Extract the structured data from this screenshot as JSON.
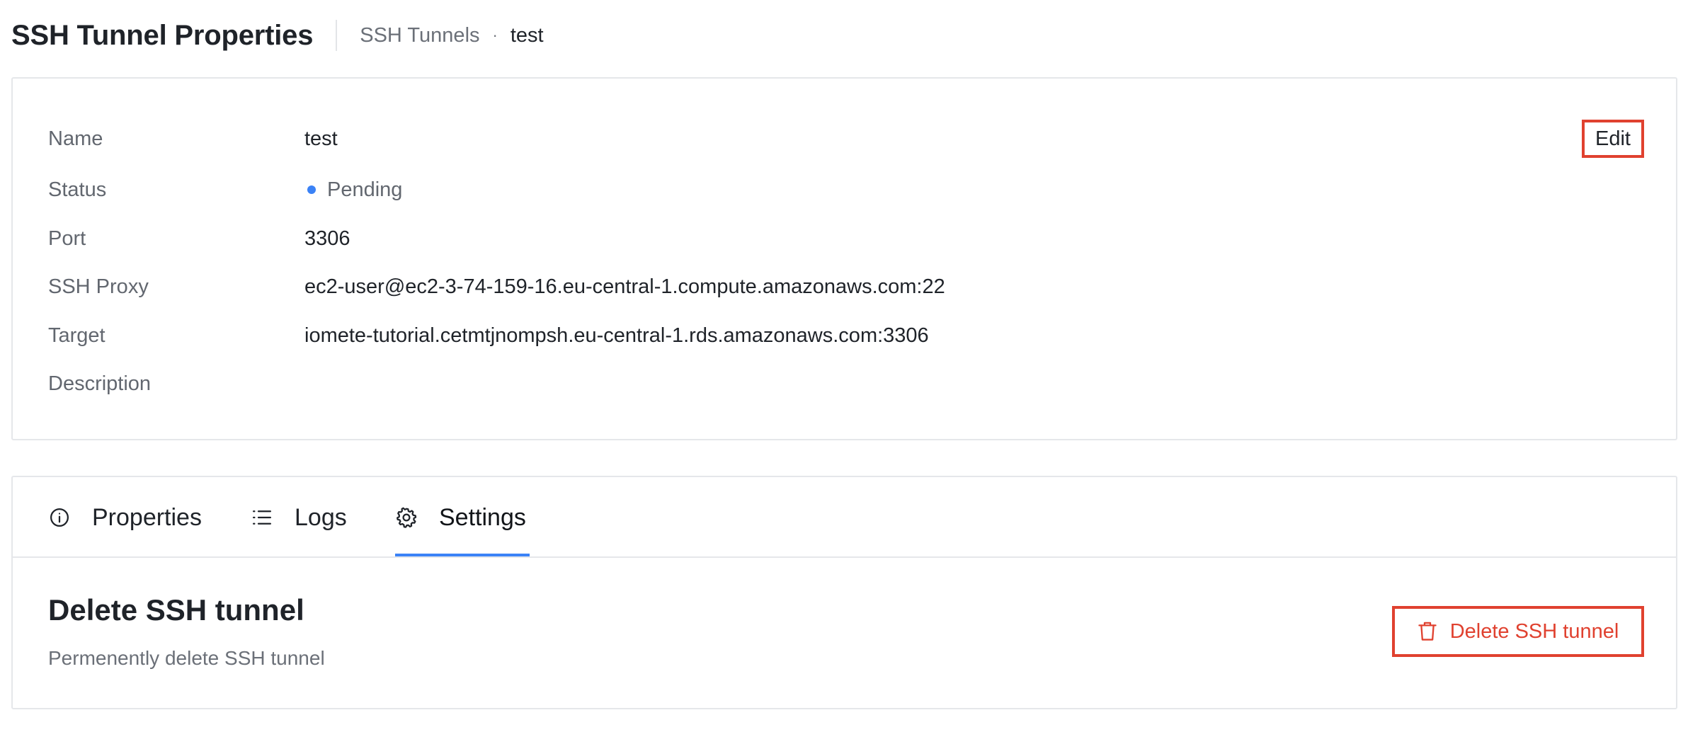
{
  "header": {
    "title": "SSH Tunnel Properties",
    "breadcrumb": {
      "parent": "SSH Tunnels",
      "separator": "·",
      "current": "test"
    }
  },
  "details": {
    "edit_label": "Edit",
    "rows": [
      {
        "label": "Name",
        "value": "test"
      },
      {
        "label": "Status",
        "value": "Pending"
      },
      {
        "label": "Port",
        "value": "3306"
      },
      {
        "label": "SSH Proxy",
        "value": "ec2-user@ec2-3-74-159-16.eu-central-1.compute.amazonaws.com:22"
      },
      {
        "label": "Target",
        "value": "iomete-tutorial.cetmtjnompsh.eu-central-1.rds.amazonaws.com:3306"
      },
      {
        "label": "Description",
        "value": ""
      }
    ],
    "status_color": "#3b82f6"
  },
  "tabs": {
    "items": [
      {
        "label": "Properties",
        "icon": "info-circle-icon"
      },
      {
        "label": "Logs",
        "icon": "list-icon"
      },
      {
        "label": "Settings",
        "icon": "gear-icon"
      }
    ],
    "active": "Settings",
    "accent_color": "#3b82f6"
  },
  "settings": {
    "title": "Delete SSH tunnel",
    "description": "Permenently delete SSH tunnel",
    "delete_label": "Delete SSH tunnel",
    "delete_icon": "trash-icon",
    "danger_color": "#e0412f"
  }
}
